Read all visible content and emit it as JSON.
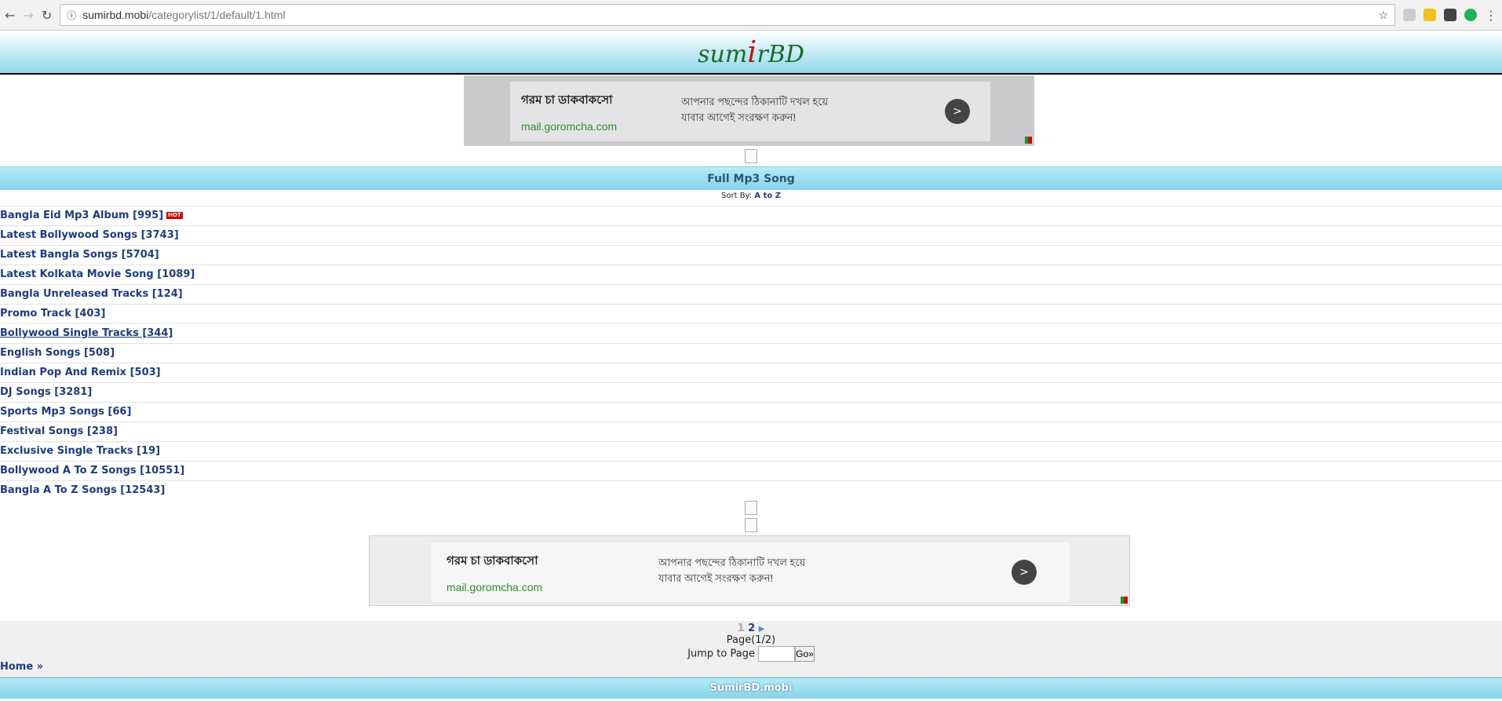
{
  "browser": {
    "url_host": "sumirbd.mobi",
    "url_path": "/categorylist/1/default/1.html"
  },
  "logo": {
    "text_left": "sum",
    "text_s": "i",
    "text_right": "rBD"
  },
  "ad": {
    "title": "গরম চা ডাকবাকসো",
    "domain": "mail.goromcha.com",
    "line1": "আপনার পছন্দের ঠিকানাটি দখল হয়ে",
    "line2": "যাবার আগেই সংরক্ষণ করুন!",
    "go": ">"
  },
  "section_title": "Full Mp3 Song",
  "sort": {
    "label": "Sort By:",
    "value": "A to Z"
  },
  "categories": [
    {
      "label": "Bangla Eid Mp3 Album [995]",
      "badge": "HOT"
    },
    {
      "label": "Latest Bollywood Songs [3743]"
    },
    {
      "label": "Latest Bangla Songs [5704]"
    },
    {
      "label": "Latest Kolkata Movie Song [1089]"
    },
    {
      "label": "Bangla Unreleased Tracks [124]"
    },
    {
      "label": "Promo Track [403]"
    },
    {
      "label": "Bollywood Single Tracks [344]"
    },
    {
      "label": "English Songs [508]"
    },
    {
      "label": "Indian Pop And Remix [503]"
    },
    {
      "label": "DJ Songs [3281]"
    },
    {
      "label": "Sports Mp3 Songs [66]"
    },
    {
      "label": "Festival Songs [238]"
    },
    {
      "label": "Exclusive Single Tracks [19]"
    },
    {
      "label": "Bollywood A To Z Songs [10551]"
    },
    {
      "label": "Bangla A To Z Songs [12543]"
    }
  ],
  "pagination": {
    "current": "1",
    "next": "2",
    "arrow": "▶",
    "page_info": "Page(1/2)",
    "jump_label": "Jump to Page",
    "go_label": "Go»"
  },
  "breadcrumb": {
    "home": "Home",
    "sep": "»"
  },
  "footer": "SumirBD.mobi"
}
